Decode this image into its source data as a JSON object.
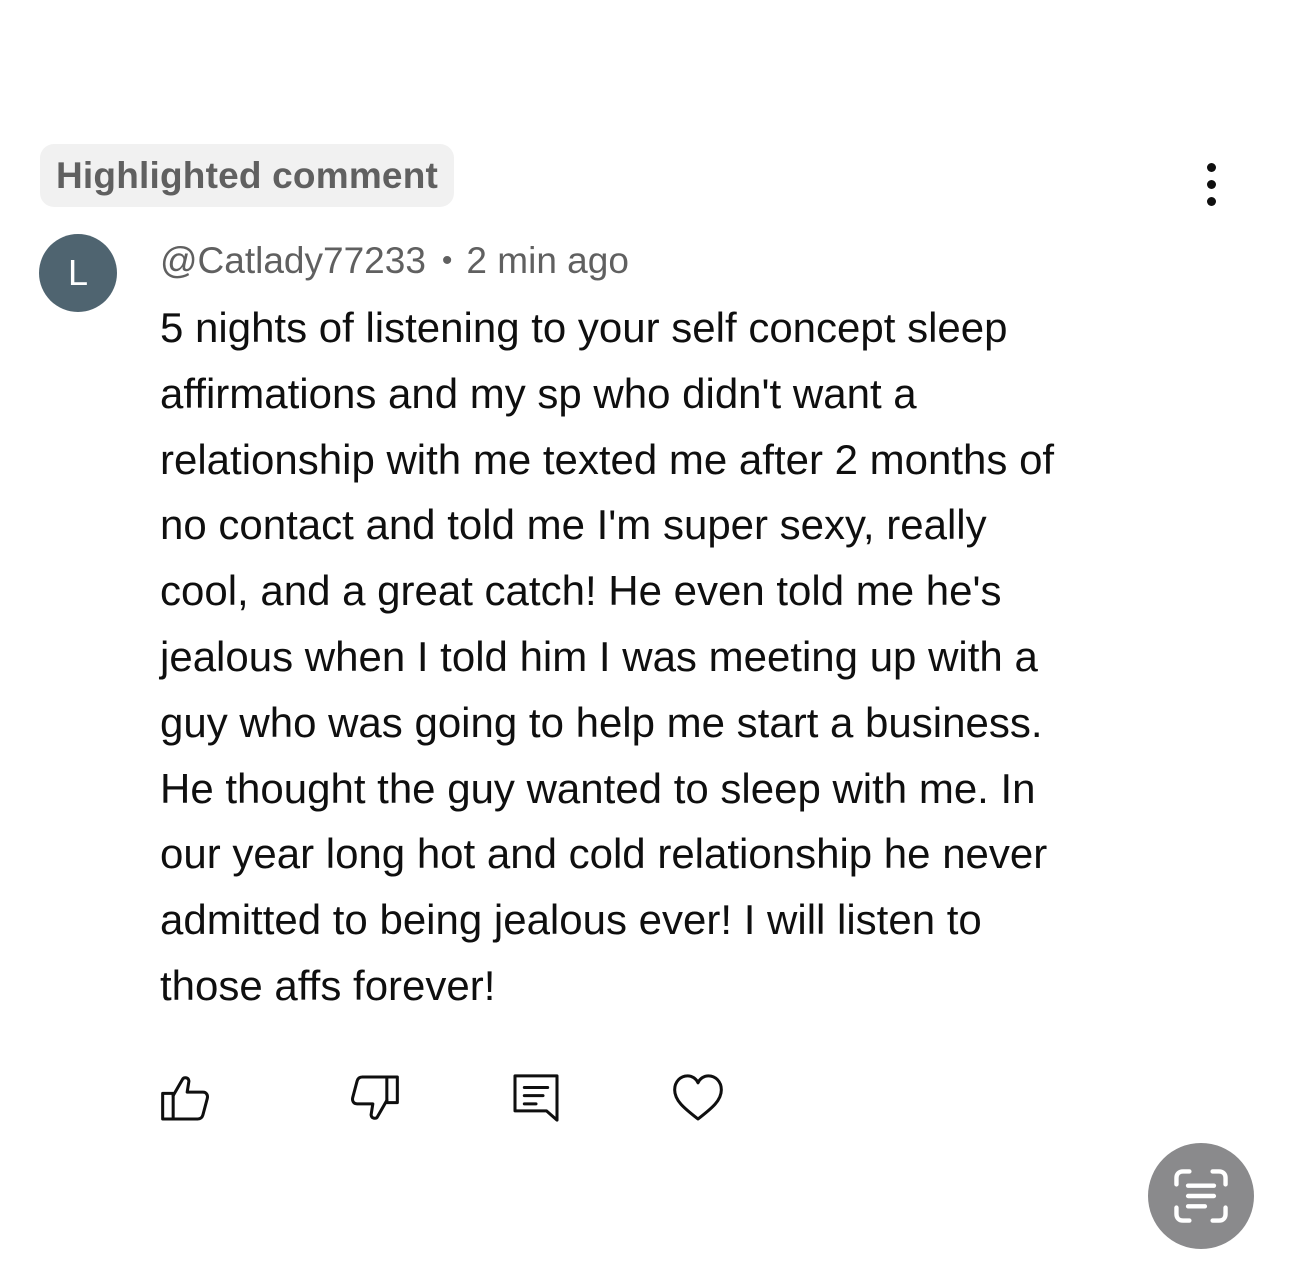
{
  "badge": {
    "label": "Highlighted comment"
  },
  "comment": {
    "avatar_initial": "L",
    "author": "@Catlady77233",
    "separator": "•",
    "timestamp": "2 min ago",
    "lines": [
      "5 nights of listening to your self concept sleep",
      "affirmations and my sp who didn't want a",
      "relationship with me texted me after 2 months of",
      "no contact and told me I'm super sexy, really",
      "cool, and a great catch! He even told me he's",
      "jealous when I told him I was meeting up with a",
      "guy who was going to help me start a business.",
      "He thought the guy wanted to sleep with me. In",
      "our year long hot and cold relationship he never",
      "admitted to being jealous ever! I will listen to",
      "those affs forever!"
    ]
  },
  "actions": {
    "like_icon": "thumbs-up-icon",
    "dislike_icon": "thumbs-down-icon",
    "reply_icon": "comment-icon",
    "heart_icon": "heart-icon"
  },
  "overlay": {
    "icon": "live-text-scan-icon"
  },
  "colors": {
    "avatar_bg": "#4f6470",
    "badge_bg": "#f1f1f1",
    "meta_text": "#606060",
    "fab_bg": "#8a8a8c"
  }
}
